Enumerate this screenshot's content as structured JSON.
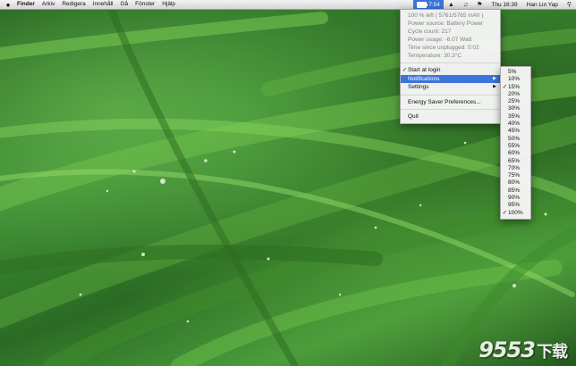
{
  "menubar": {
    "apple_icon": "apple-icon",
    "app_name": "Finder",
    "menus": [
      "Arkiv",
      "Redigera",
      "Innehåll",
      "Gå",
      "Fönster",
      "Hjälp"
    ],
    "battery_time": "7:54",
    "clock": "Thu 16:39",
    "user": "Han Lin Yap",
    "status_icons": [
      "battery-icon",
      "wifi-icon",
      "volume-icon",
      "flag-icon"
    ]
  },
  "battery_menu": {
    "info": [
      "100 % left ( 5761/5765 mAh )",
      "Power source: Battery Power",
      "Cycle count: 217",
      "Power usage: -6.07 Watt",
      "Time since unplugged: 0:02",
      "Temperature: 30.3°C"
    ],
    "items": {
      "start_at_login": "Start at login",
      "notifications": "Notifications",
      "settings": "Settings",
      "energy_saver": "Energy Saver Preferences...",
      "quit": "Quit"
    }
  },
  "notifications_submenu": {
    "options": [
      "5%",
      "10%",
      "15%",
      "20%",
      "25%",
      "30%",
      "35%",
      "40%",
      "45%",
      "50%",
      "55%",
      "60%",
      "65%",
      "70%",
      "75%",
      "80%",
      "85%",
      "90%",
      "95%",
      "100%"
    ],
    "checked": [
      "15%",
      "100%"
    ]
  },
  "watermark": {
    "number": "9553",
    "chinese": "下载"
  },
  "colors": {
    "highlight": "#3d74d9",
    "menubar": "#e8e8e8"
  }
}
